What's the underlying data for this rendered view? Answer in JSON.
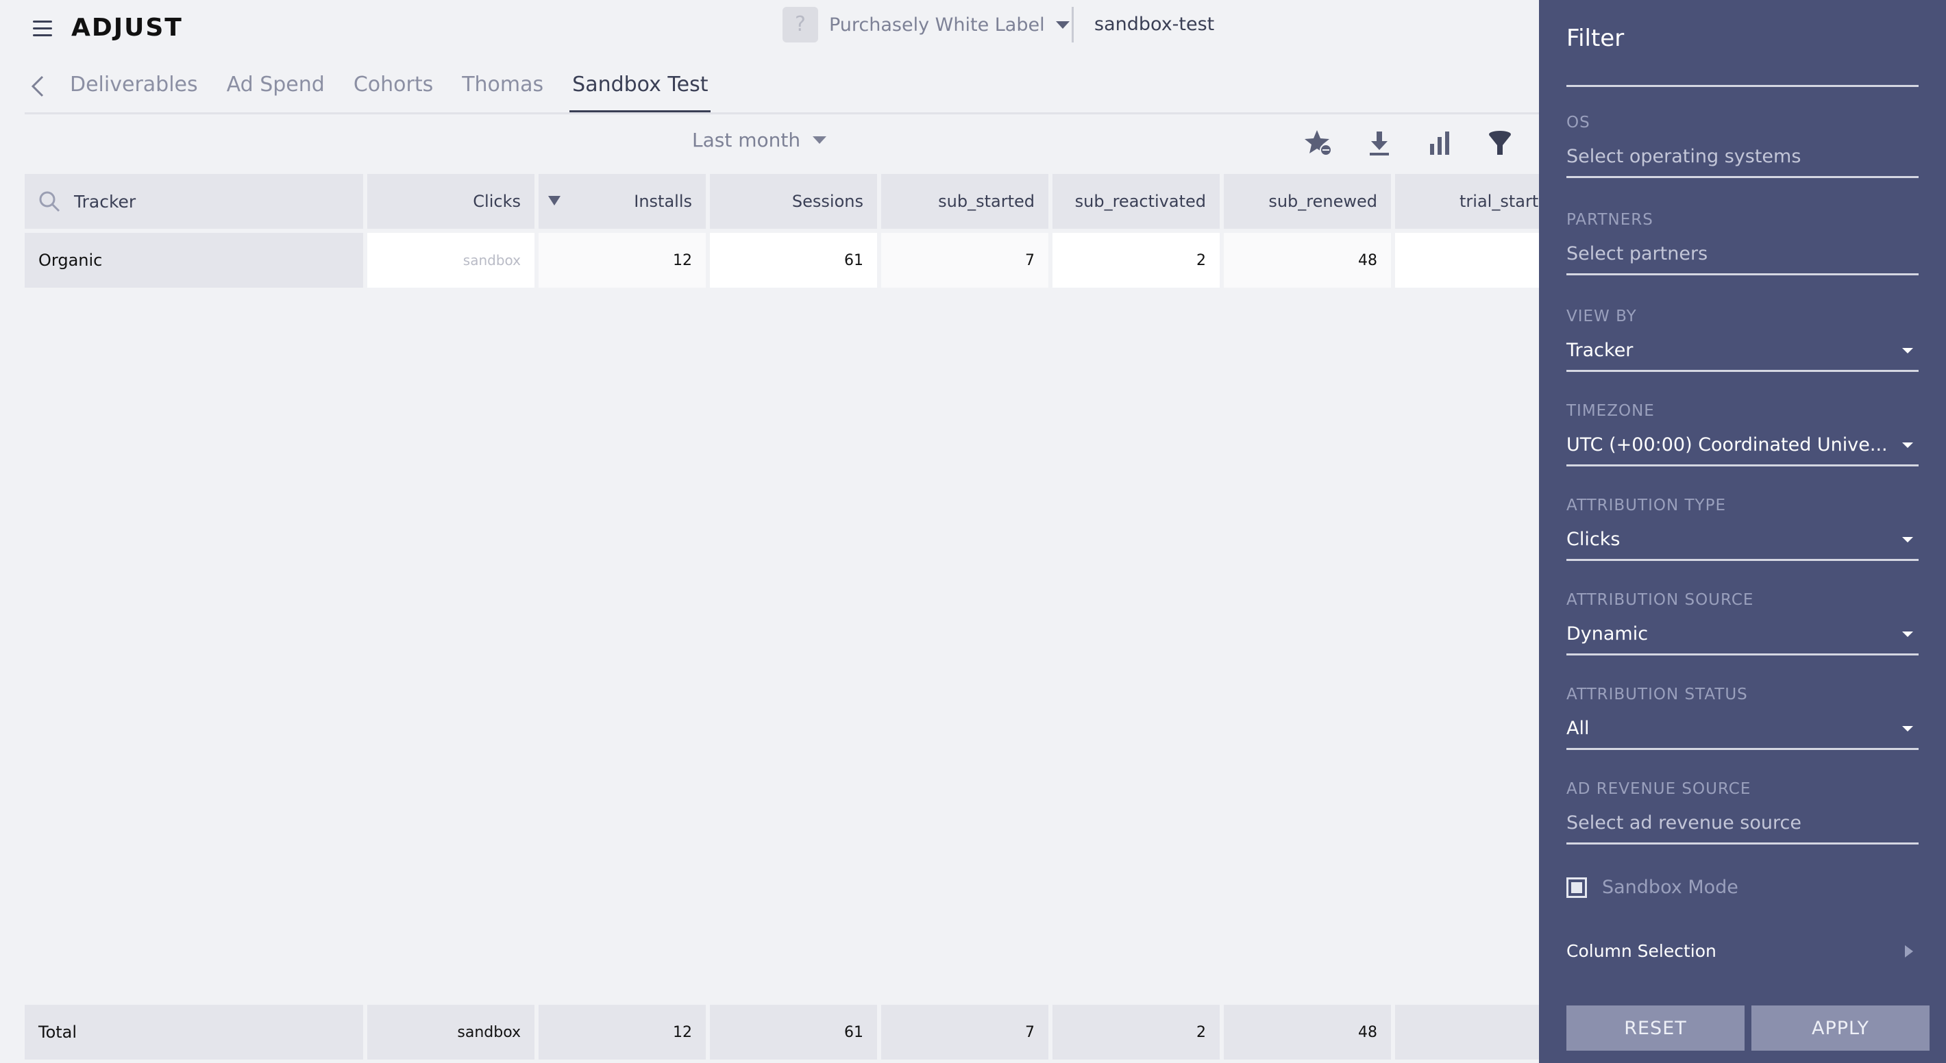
{
  "brand": {
    "logo": "ADJUST"
  },
  "header": {
    "app_name": "Purchasely White Label",
    "app_qmark": "?",
    "workspace": "sandbox-test"
  },
  "tabs": [
    {
      "label": "Deliverables",
      "active": false
    },
    {
      "label": "Ad Spend",
      "active": false
    },
    {
      "label": "Cohorts",
      "active": false
    },
    {
      "label": "Thomas",
      "active": false
    },
    {
      "label": "Sandbox Test",
      "active": true
    }
  ],
  "toolbar": {
    "period": "Last month",
    "icons": [
      "favorite-star-icon",
      "download-icon",
      "chart-icon",
      "filter-icon"
    ]
  },
  "table": {
    "search_label": "Tracker",
    "columns": [
      "Clicks",
      "Installs",
      "Sessions",
      "sub_started",
      "sub_reactivated",
      "sub_renewed",
      "trial_starte"
    ],
    "rows": [
      {
        "name": "Organic",
        "values": [
          "sandbox",
          "12",
          "61",
          "7",
          "2",
          "48",
          ""
        ]
      }
    ],
    "total": {
      "name": "Total",
      "values": [
        "sandbox",
        "12",
        "61",
        "7",
        "2",
        "48",
        ""
      ]
    }
  },
  "filter": {
    "title": "Filter",
    "fields": [
      {
        "label": "OS",
        "value": "Select operating systems",
        "placeholder": true,
        "dropdown": false
      },
      {
        "label": "PARTNERS",
        "value": "Select partners",
        "placeholder": true,
        "dropdown": false
      },
      {
        "label": "VIEW BY",
        "value": "Tracker",
        "placeholder": false,
        "dropdown": true
      },
      {
        "label": "TIMEZONE",
        "value": "UTC (+00:00) Coordinated Unive...",
        "placeholder": false,
        "dropdown": true
      },
      {
        "label": "ATTRIBUTION TYPE",
        "value": "Clicks",
        "placeholder": false,
        "dropdown": true
      },
      {
        "label": "ATTRIBUTION SOURCE",
        "value": "Dynamic",
        "placeholder": false,
        "dropdown": true
      },
      {
        "label": "ATTRIBUTION STATUS",
        "value": "All",
        "placeholder": false,
        "dropdown": true
      },
      {
        "label": "AD REVENUE SOURCE",
        "value": "Select ad revenue source",
        "placeholder": true,
        "dropdown": false
      }
    ],
    "sandbox_mode": "Sandbox Mode",
    "column_selection": "Column Selection",
    "reset": "RESET",
    "apply": "APPLY"
  },
  "colors": {
    "panel_bg": "#4a5177",
    "page_bg": "#f1f2f5",
    "header_cell": "#e4e5eb",
    "button_bg": "#8b90ad"
  }
}
